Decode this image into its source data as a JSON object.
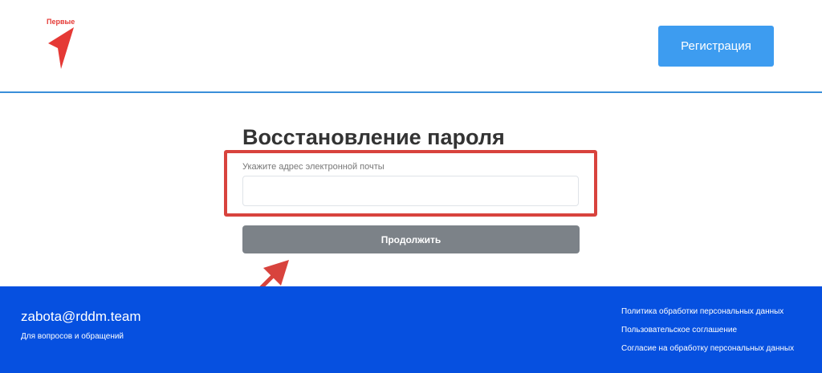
{
  "header": {
    "logo_text": "Первые",
    "register_label": "Регистрация",
    "brand_color": "#e53935",
    "accent_color": "#3d9cf0"
  },
  "main": {
    "title": "Восстановление пароля",
    "email_label": "Укажите адрес электронной почты",
    "email_value": "",
    "continue_label": "Продолжить",
    "highlight_color": "#d8433d"
  },
  "footer": {
    "email": "zabota@rddm.team",
    "note": "Для вопросов и обращений",
    "links": [
      "Политика обработки персональных данных",
      "Пользовательское соглашение",
      "Согласие на обработку персональных данных"
    ],
    "background_color": "#0650e0"
  }
}
